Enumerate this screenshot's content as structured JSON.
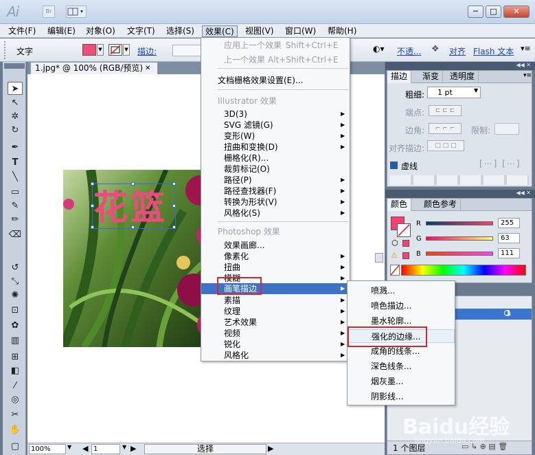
{
  "app": {
    "logo": "Ai",
    "bridge": "Br",
    "window_controls": [
      "─",
      "□",
      "✕"
    ]
  },
  "menubar": [
    {
      "label": "文件(F)"
    },
    {
      "label": "编辑(E)"
    },
    {
      "label": "对象(O)"
    },
    {
      "label": "文字(T)"
    },
    {
      "label": "选择(S)"
    },
    {
      "label": "效果(C)",
      "active": true
    },
    {
      "label": "视图(V)"
    },
    {
      "label": "窗口(W)"
    },
    {
      "label": "帮助(H)"
    }
  ],
  "control_bar": {
    "mode": "文字",
    "fill_color": "#f24c78",
    "stroke_label": "描边:",
    "opacity_link": "不透...",
    "align_link": "对齐",
    "flash_link": "Flash 文本"
  },
  "document": {
    "tab_title": "1.jpg* @ 100% (RGB/预览)",
    "close": "✕",
    "canvas_text": "花篮",
    "text_color": "#ee4a7e"
  },
  "status_bar": {
    "zoom": "100%",
    "page": "1",
    "tool": "选择"
  },
  "effect_menu": {
    "items": [
      {
        "label": "应用上一个效果",
        "shortcut": "Shift+Ctrl+E",
        "disabled": true
      },
      {
        "label": "上一个效果",
        "shortcut": "Alt+Shift+Ctrl+E",
        "disabled": true
      },
      {
        "label": "文档栅格效果设置(E)..."
      },
      {
        "label": "Illustrator 效果",
        "header": true
      },
      {
        "label": "3D(3)",
        "sub": true
      },
      {
        "label": "SVG 滤镜(G)",
        "sub": true
      },
      {
        "label": "变形(W)",
        "sub": true
      },
      {
        "label": "扭曲和变换(D)",
        "sub": true
      },
      {
        "label": "栅格化(R)..."
      },
      {
        "label": "裁剪标记(O)"
      },
      {
        "label": "路径(P)",
        "sub": true
      },
      {
        "label": "路径查找器(F)",
        "sub": true
      },
      {
        "label": "转换为形状(V)",
        "sub": true
      },
      {
        "label": "风格化(S)",
        "sub": true
      },
      {
        "label": "Photoshop 效果",
        "header": true
      },
      {
        "label": "效果画廊..."
      },
      {
        "label": "像素化",
        "sub": true
      },
      {
        "label": "扭曲",
        "sub": true
      },
      {
        "label": "模糊",
        "sub": true
      },
      {
        "label": "画笔描边",
        "sub": true,
        "highlighted": true
      },
      {
        "label": "素描",
        "sub": true
      },
      {
        "label": "纹理",
        "sub": true
      },
      {
        "label": "艺术效果",
        "sub": true
      },
      {
        "label": "视频",
        "sub": true
      },
      {
        "label": "锐化",
        "sub": true
      },
      {
        "label": "风格化",
        "sub": true
      }
    ]
  },
  "brush_submenu": {
    "items": [
      "喷溅...",
      "喷色描边...",
      "墨水轮廓...",
      "强化的边缘...",
      "成角的线条...",
      "深色线条...",
      "烟灰墨...",
      "阴影线..."
    ],
    "hovered": "强化的边缘..."
  },
  "stroke_panel": {
    "tabs": [
      "描边",
      "渐变",
      "透明度"
    ],
    "weight_label": "粗细:",
    "weight_value": "1 pt",
    "cap_label": "端点:",
    "corner_label": "边角:",
    "limit_label": "限制:",
    "align_label": "对齐描边:",
    "dashed_label": "虚线"
  },
  "color_panel": {
    "tabs": [
      "颜色",
      "颜色参考"
    ],
    "r_label": "R",
    "r": "255",
    "g_label": "G",
    "g": "63",
    "b_label": "B",
    "b": "111",
    "color": "#ff3f6f"
  },
  "layers_panel": {
    "layer_num": "1",
    "footer": "1 个图层"
  },
  "watermark": {
    "brand": "Baidu经验",
    "url": "jingyan.baidu.com"
  }
}
